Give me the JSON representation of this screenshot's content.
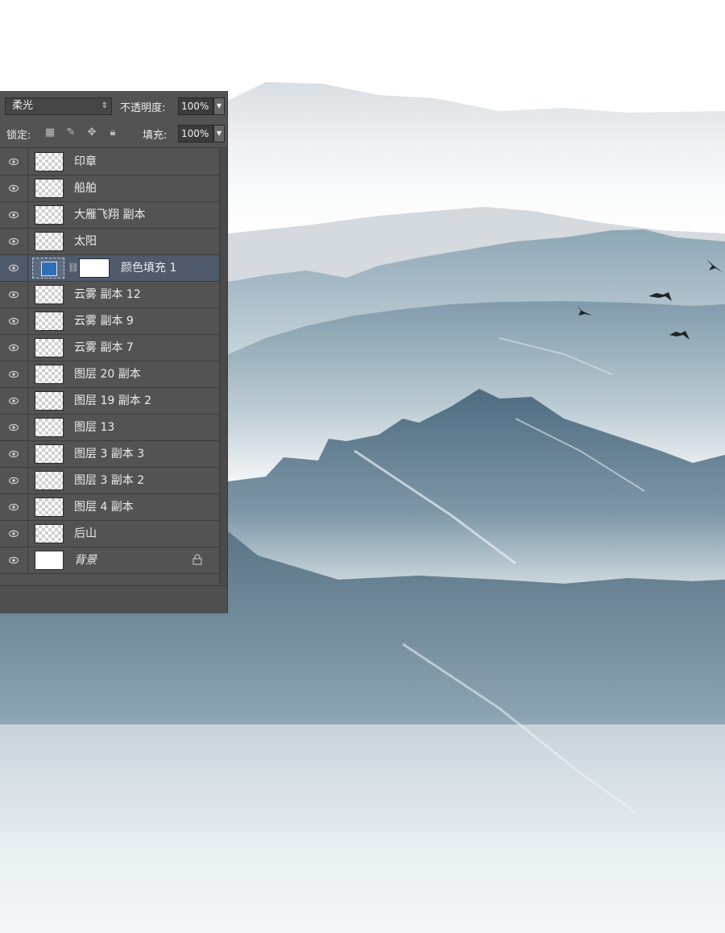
{
  "layers_panel": {
    "blend_mode": "柔光",
    "opacity_label": "不透明度:",
    "opacity_value": "100%",
    "lock_label": "锁定:",
    "fill_label": "填充:",
    "fill_value": "100%",
    "layers": [
      {
        "name": "印章",
        "thumb": "transparent",
        "visible": true
      },
      {
        "name": "船舶",
        "thumb": "transparent",
        "visible": true
      },
      {
        "name": "大雁飞翔 副本",
        "thumb": "transparent",
        "visible": true
      },
      {
        "name": "太阳",
        "thumb": "transparent",
        "visible": true
      },
      {
        "name": "颜色填充 1",
        "thumb": "color-fill",
        "visible": true,
        "selected": true,
        "fill_color": "#2f6eb8"
      },
      {
        "name": "云雾 副本 12",
        "thumb": "transparent",
        "visible": true
      },
      {
        "name": "云雾 副本 9",
        "thumb": "transparent",
        "visible": true
      },
      {
        "name": "云雾 副本 7",
        "thumb": "transparent",
        "visible": true
      },
      {
        "name": "图层 20 副本",
        "thumb": "transparent",
        "visible": true
      },
      {
        "name": "图层 19 副本 2",
        "thumb": "transparent",
        "visible": true
      },
      {
        "name": "图层 13",
        "thumb": "transparent",
        "visible": true
      },
      {
        "name": "图层 3 副本 3",
        "thumb": "transparent",
        "visible": true
      },
      {
        "name": "图层 3 副本 2",
        "thumb": "transparent",
        "visible": true
      },
      {
        "name": "图层 4 副本",
        "thumb": "transparent",
        "visible": true
      },
      {
        "name": "后山",
        "thumb": "transparent",
        "visible": true
      },
      {
        "name": "背景",
        "thumb": "white",
        "visible": true,
        "locked": true,
        "italic": true
      }
    ]
  },
  "colors": {
    "panel_bg": "#535353",
    "selected_row": "#4f5a6b",
    "mountain_dark": "#4d6a7f",
    "mountain_mid": "#7e98a8",
    "mountain_light": "#c3cdd3",
    "mist": "#eef2f4"
  }
}
